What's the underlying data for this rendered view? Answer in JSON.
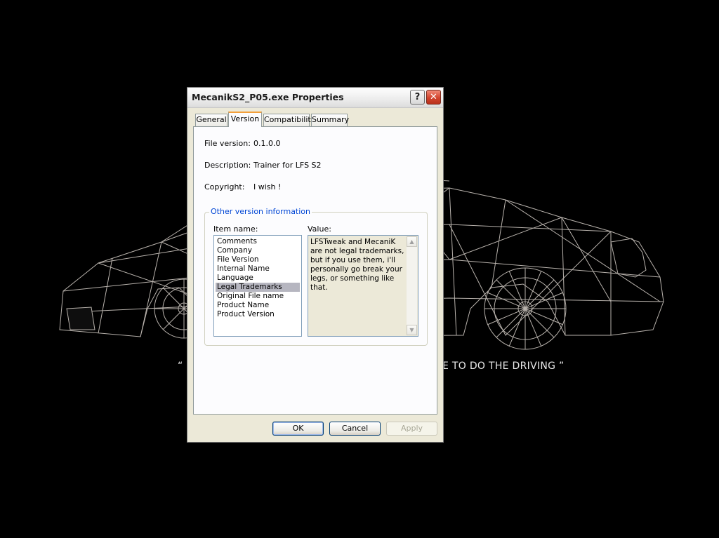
{
  "wallpaper": {
    "quote_left": "“ N",
    "quote_right": "E TO DO THE DRIVING ”"
  },
  "window": {
    "title": "MecanikS2_P05.exe Properties",
    "help_glyph": "?",
    "close_glyph": "✕"
  },
  "tabs": [
    {
      "label": "General",
      "active": false
    },
    {
      "label": "Version",
      "active": true
    },
    {
      "label": "Compatibility",
      "active": false
    },
    {
      "label": "Summary",
      "active": false
    }
  ],
  "fields": {
    "file_version": {
      "label": "File version:",
      "value": "0.1.0.0"
    },
    "description": {
      "label": "Description:",
      "value": "Trainer for LFS S2"
    },
    "copyright": {
      "label": "Copyright:",
      "value": "I wish !"
    }
  },
  "other_version": {
    "group_title": "Other version information",
    "item_name_label": "Item name:",
    "value_label": "Value:",
    "items": [
      "Comments",
      "Company",
      "File Version",
      "Internal Name",
      "Language",
      "Legal Trademarks",
      "Original File name",
      "Product Name",
      "Product Version"
    ],
    "selected_item": "Legal Trademarks",
    "value_text": "LFSTweak and MecaniK are not legal trademarks, but if you use them, i'll personally go break your legs, or something like that."
  },
  "buttons": {
    "ok": "OK",
    "cancel": "Cancel",
    "apply": "Apply"
  },
  "colors": {
    "window_bg": "#ece9d8",
    "active_tab_accent": "#f3a03b",
    "group_title": "#0046d5",
    "close_button": "#d2452e"
  }
}
